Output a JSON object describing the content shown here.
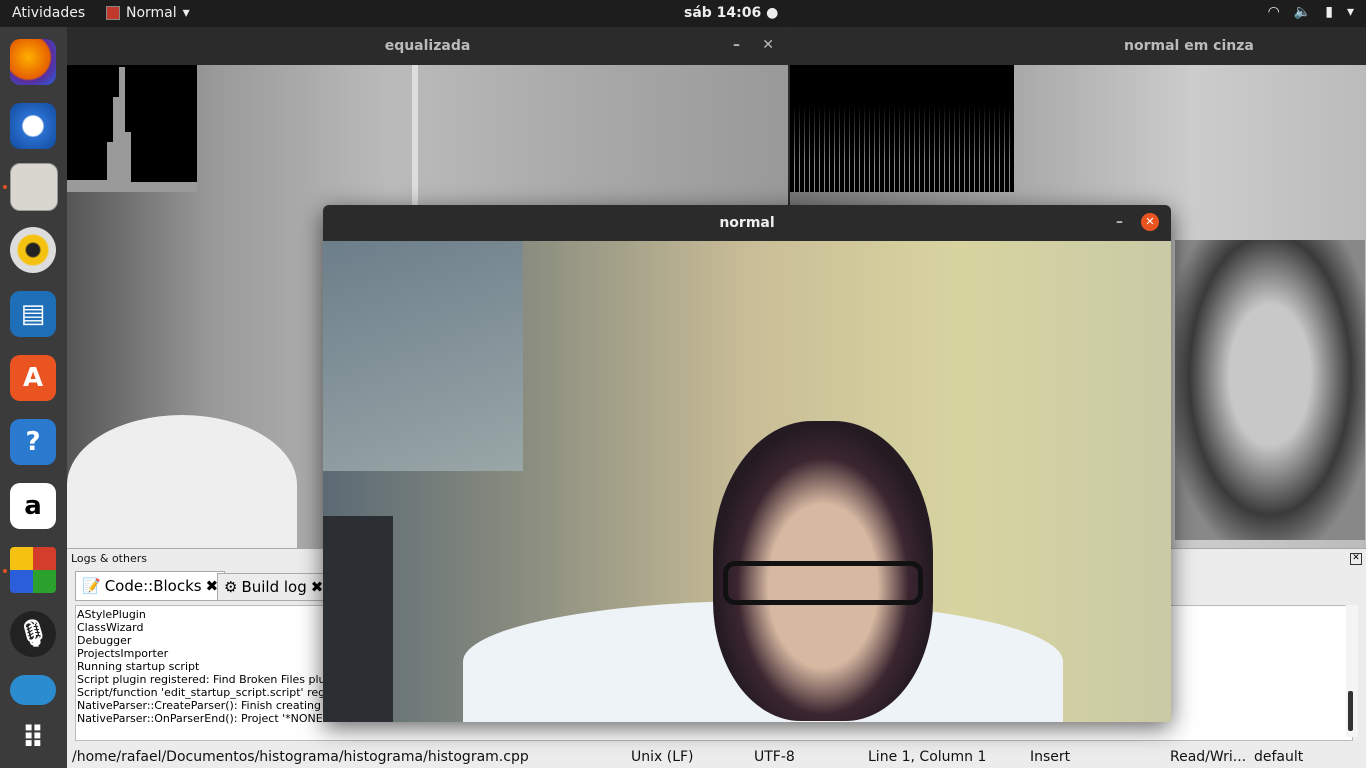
{
  "topbar": {
    "activities": "Atividades",
    "app_name": "Normal",
    "clock": "sáb 14:06"
  },
  "dock": {
    "icons": [
      "firefox-icon",
      "thunderbird-icon",
      "files-icon",
      "rhythmbox-icon",
      "writer-icon",
      "software-icon",
      "help-icon",
      "amazon-icon",
      "codeblocks-icon",
      "voice-icon",
      "telegram-icon",
      "apps-grid-icon"
    ]
  },
  "windows": {
    "equalizada": {
      "title": "equalizada"
    },
    "cinza": {
      "title": "normal em cinza"
    },
    "normal": {
      "title": "normal"
    }
  },
  "logs": {
    "header": "Logs & others",
    "tabs": [
      {
        "label": "Code::Blocks"
      },
      {
        "label": "Build log"
      }
    ],
    "lines": [
      "AStylePlugin",
      "ClassWizard",
      "Debugger",
      "ProjectsImporter",
      "Running startup script",
      "Script plugin registered: Find Broken Files plug",
      "Script/function 'edit_startup_script.script' regi",
      "NativeParser::CreateParser(): Finish creating a",
      "NativeParser::OnParserEnd(): Project '*NONE*'"
    ]
  },
  "status": {
    "path": "/home/rafael/Documentos/histograma/histograma/histogram.cpp",
    "eol": "Unix (LF)",
    "encoding": "UTF-8",
    "position": "Line 1, Column 1",
    "mode": "Insert",
    "access": "Read/Wri...",
    "profile": "default"
  },
  "colors": {
    "accent": "#e95420",
    "dock": "#3b3b3b",
    "topbar": "#1d1d1d"
  }
}
